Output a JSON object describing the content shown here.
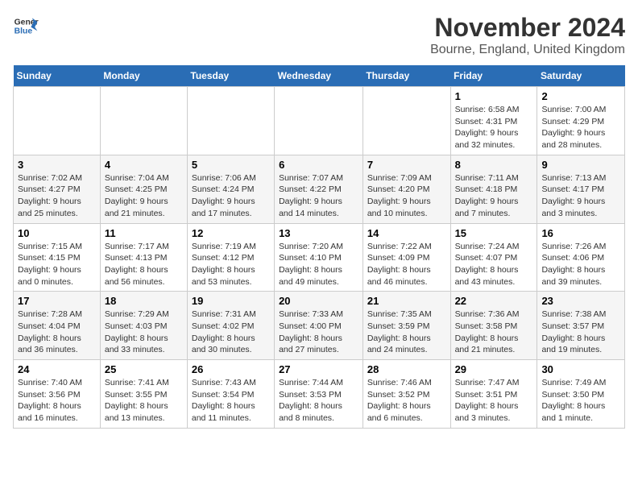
{
  "logo": {
    "line1": "General",
    "line2": "Blue"
  },
  "title": "November 2024",
  "subtitle": "Bourne, England, United Kingdom",
  "weekdays": [
    "Sunday",
    "Monday",
    "Tuesday",
    "Wednesday",
    "Thursday",
    "Friday",
    "Saturday"
  ],
  "weeks": [
    [
      {
        "day": "",
        "info": ""
      },
      {
        "day": "",
        "info": ""
      },
      {
        "day": "",
        "info": ""
      },
      {
        "day": "",
        "info": ""
      },
      {
        "day": "",
        "info": ""
      },
      {
        "day": "1",
        "info": "Sunrise: 6:58 AM\nSunset: 4:31 PM\nDaylight: 9 hours and 32 minutes."
      },
      {
        "day": "2",
        "info": "Sunrise: 7:00 AM\nSunset: 4:29 PM\nDaylight: 9 hours and 28 minutes."
      }
    ],
    [
      {
        "day": "3",
        "info": "Sunrise: 7:02 AM\nSunset: 4:27 PM\nDaylight: 9 hours and 25 minutes."
      },
      {
        "day": "4",
        "info": "Sunrise: 7:04 AM\nSunset: 4:25 PM\nDaylight: 9 hours and 21 minutes."
      },
      {
        "day": "5",
        "info": "Sunrise: 7:06 AM\nSunset: 4:24 PM\nDaylight: 9 hours and 17 minutes."
      },
      {
        "day": "6",
        "info": "Sunrise: 7:07 AM\nSunset: 4:22 PM\nDaylight: 9 hours and 14 minutes."
      },
      {
        "day": "7",
        "info": "Sunrise: 7:09 AM\nSunset: 4:20 PM\nDaylight: 9 hours and 10 minutes."
      },
      {
        "day": "8",
        "info": "Sunrise: 7:11 AM\nSunset: 4:18 PM\nDaylight: 9 hours and 7 minutes."
      },
      {
        "day": "9",
        "info": "Sunrise: 7:13 AM\nSunset: 4:17 PM\nDaylight: 9 hours and 3 minutes."
      }
    ],
    [
      {
        "day": "10",
        "info": "Sunrise: 7:15 AM\nSunset: 4:15 PM\nDaylight: 9 hours and 0 minutes."
      },
      {
        "day": "11",
        "info": "Sunrise: 7:17 AM\nSunset: 4:13 PM\nDaylight: 8 hours and 56 minutes."
      },
      {
        "day": "12",
        "info": "Sunrise: 7:19 AM\nSunset: 4:12 PM\nDaylight: 8 hours and 53 minutes."
      },
      {
        "day": "13",
        "info": "Sunrise: 7:20 AM\nSunset: 4:10 PM\nDaylight: 8 hours and 49 minutes."
      },
      {
        "day": "14",
        "info": "Sunrise: 7:22 AM\nSunset: 4:09 PM\nDaylight: 8 hours and 46 minutes."
      },
      {
        "day": "15",
        "info": "Sunrise: 7:24 AM\nSunset: 4:07 PM\nDaylight: 8 hours and 43 minutes."
      },
      {
        "day": "16",
        "info": "Sunrise: 7:26 AM\nSunset: 4:06 PM\nDaylight: 8 hours and 39 minutes."
      }
    ],
    [
      {
        "day": "17",
        "info": "Sunrise: 7:28 AM\nSunset: 4:04 PM\nDaylight: 8 hours and 36 minutes."
      },
      {
        "day": "18",
        "info": "Sunrise: 7:29 AM\nSunset: 4:03 PM\nDaylight: 8 hours and 33 minutes."
      },
      {
        "day": "19",
        "info": "Sunrise: 7:31 AM\nSunset: 4:02 PM\nDaylight: 8 hours and 30 minutes."
      },
      {
        "day": "20",
        "info": "Sunrise: 7:33 AM\nSunset: 4:00 PM\nDaylight: 8 hours and 27 minutes."
      },
      {
        "day": "21",
        "info": "Sunrise: 7:35 AM\nSunset: 3:59 PM\nDaylight: 8 hours and 24 minutes."
      },
      {
        "day": "22",
        "info": "Sunrise: 7:36 AM\nSunset: 3:58 PM\nDaylight: 8 hours and 21 minutes."
      },
      {
        "day": "23",
        "info": "Sunrise: 7:38 AM\nSunset: 3:57 PM\nDaylight: 8 hours and 19 minutes."
      }
    ],
    [
      {
        "day": "24",
        "info": "Sunrise: 7:40 AM\nSunset: 3:56 PM\nDaylight: 8 hours and 16 minutes."
      },
      {
        "day": "25",
        "info": "Sunrise: 7:41 AM\nSunset: 3:55 PM\nDaylight: 8 hours and 13 minutes."
      },
      {
        "day": "26",
        "info": "Sunrise: 7:43 AM\nSunset: 3:54 PM\nDaylight: 8 hours and 11 minutes."
      },
      {
        "day": "27",
        "info": "Sunrise: 7:44 AM\nSunset: 3:53 PM\nDaylight: 8 hours and 8 minutes."
      },
      {
        "day": "28",
        "info": "Sunrise: 7:46 AM\nSunset: 3:52 PM\nDaylight: 8 hours and 6 minutes."
      },
      {
        "day": "29",
        "info": "Sunrise: 7:47 AM\nSunset: 3:51 PM\nDaylight: 8 hours and 3 minutes."
      },
      {
        "day": "30",
        "info": "Sunrise: 7:49 AM\nSunset: 3:50 PM\nDaylight: 8 hours and 1 minute."
      }
    ]
  ]
}
